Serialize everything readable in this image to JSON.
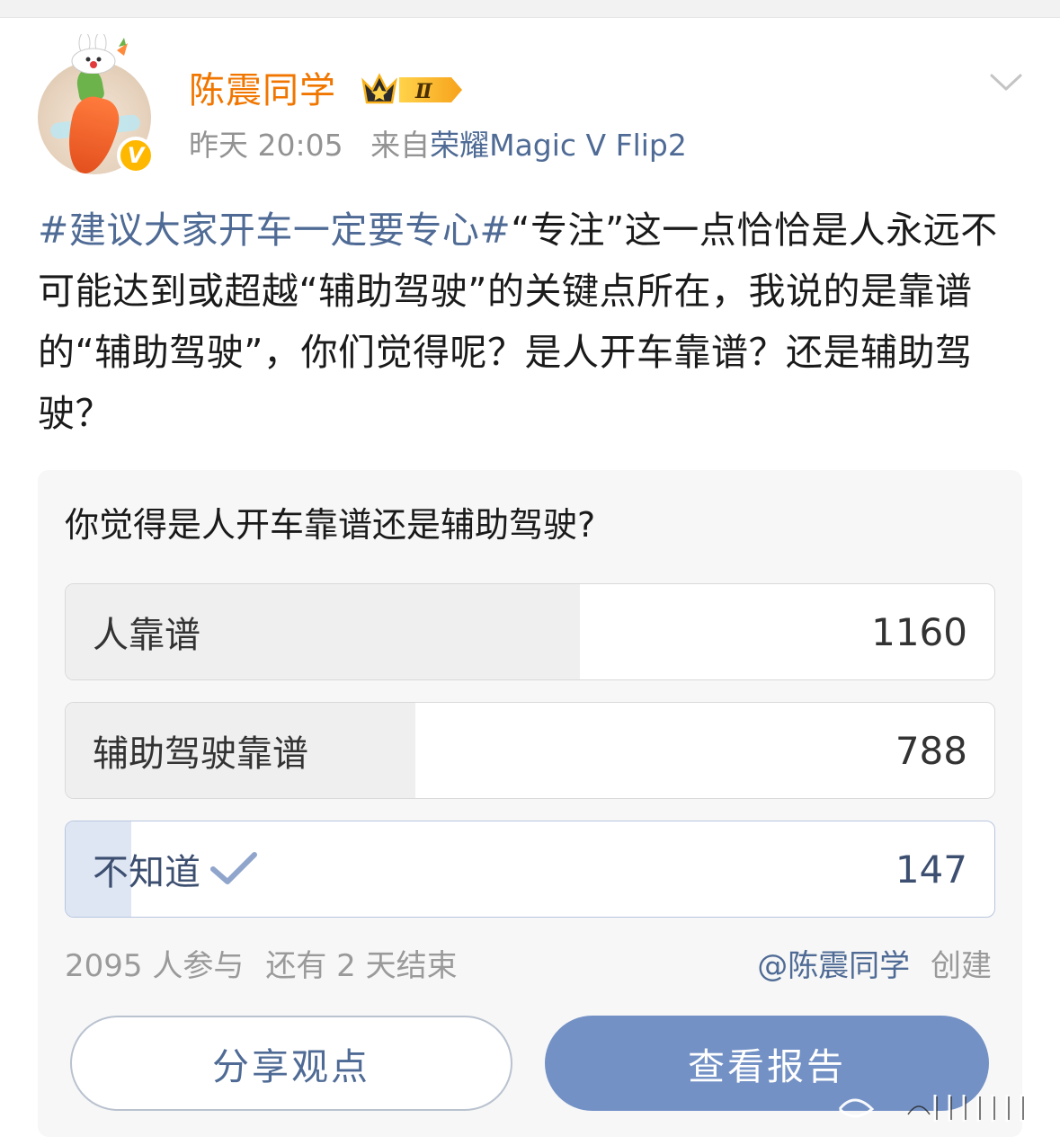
{
  "post": {
    "username": "陈震同学",
    "vip_level": "Ⅱ",
    "verified_mark": "V",
    "time": "昨天 20:05",
    "source_prefix": "来自",
    "source_device": "荣耀Magic V Flip2",
    "hashtag": "#建议大家开车一定要专心#",
    "text": "“专注”这一点恰恰是人永远不可能达到或超越“辅助驾驶”的关键点所在，我说的是靠谱的“辅助驾驶”，你们觉得呢？是人开车靠谱？还是辅助驾驶？"
  },
  "poll": {
    "question": "你觉得是人开车靠谱还是辅助驾驶?",
    "options": [
      {
        "label": "人靠谱",
        "count": "1160",
        "share": 0.5537,
        "selected": false
      },
      {
        "label": "辅助驾驶靠谱",
        "count": "788",
        "share": 0.3761,
        "selected": false
      },
      {
        "label": "不知道",
        "count": "147",
        "share": 0.0702,
        "selected": true
      }
    ],
    "participants": "2095 人参与",
    "remaining": "还有 2 天结束",
    "creator_handle": "@陈震同学",
    "creator_suffix": "创建",
    "share_button": "分享观点",
    "report_button": "查看报告"
  },
  "icons": {
    "avatar": "carrot-avatar",
    "verified": "verified-badge-icon",
    "vip": "crown-vip-icon",
    "more": "chevron-down-icon",
    "check": "checkmark-icon"
  },
  "colors": {
    "username": "#f07600",
    "link": "#4f6b95",
    "primary_button": "#7391c5",
    "selected_fill": "#dfe6f3"
  }
}
